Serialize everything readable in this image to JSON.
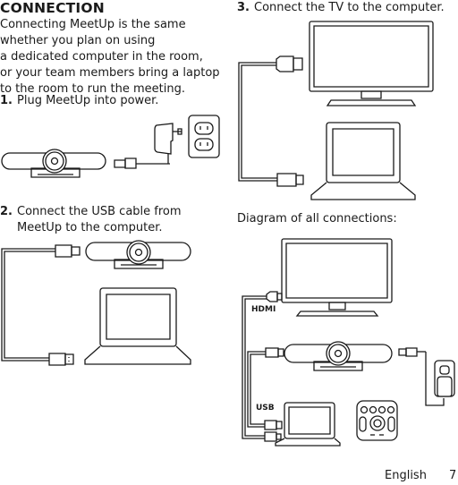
{
  "section": {
    "title": "CONNECTION",
    "intro_lines": [
      "Connecting MeetUp is the same",
      "whether you plan on using",
      "a dedicated computer in the room,",
      "or your team members bring a laptop",
      "to the room to run the meeting."
    ]
  },
  "steps": [
    {
      "number": "1.",
      "lines": [
        "Plug MeetUp into power."
      ]
    },
    {
      "number": "2.",
      "lines": [
        "Connect the USB cable from",
        "MeetUp to the computer."
      ]
    },
    {
      "number": "3.",
      "lines": [
        "Connect the TV to the computer."
      ]
    }
  ],
  "diagram": {
    "caption": "Diagram of all connections:",
    "labels": {
      "hdmi": "HDMI",
      "usb": "USB"
    }
  },
  "illustrations": {
    "step1": [
      "meetup-camera",
      "power-adapter",
      "wall-outlet"
    ],
    "step2": [
      "usb-cable",
      "meetup-camera",
      "laptop"
    ],
    "step3": [
      "hdmi-cable",
      "tv",
      "laptop"
    ],
    "all": [
      "tv",
      "hdmi-cable",
      "meetup-camera",
      "usb-cable",
      "laptop",
      "remote-control",
      "power-adapter",
      "wall-outlet"
    ]
  },
  "footer": {
    "language": "English",
    "page": "7"
  }
}
